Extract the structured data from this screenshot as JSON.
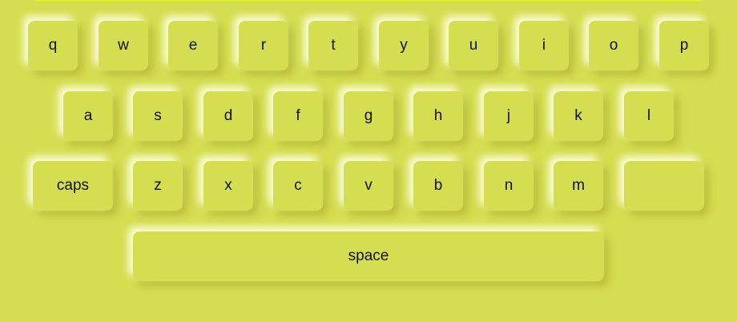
{
  "keyboard": {
    "row1": [
      "q",
      "w",
      "e",
      "r",
      "t",
      "y",
      "u",
      "i",
      "o",
      "p"
    ],
    "row2": [
      "a",
      "s",
      "d",
      "f",
      "g",
      "h",
      "j",
      "k",
      "l"
    ],
    "row3": [
      "z",
      "x",
      "c",
      "v",
      "b",
      "n",
      "m"
    ],
    "caps_label": "caps",
    "space_label": "space",
    "blank_label": ""
  }
}
